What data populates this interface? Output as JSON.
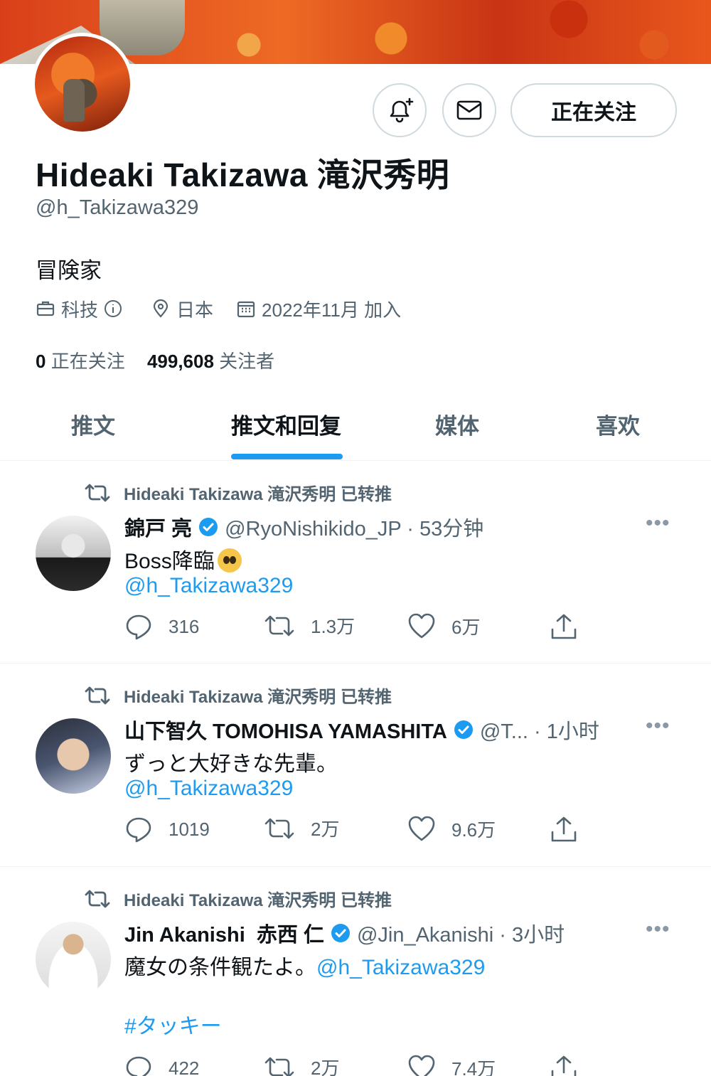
{
  "profile": {
    "display_name": "Hideaki Takizawa 滝沢秀明",
    "handle": "@h_Takizawa329",
    "bio": "冒険家",
    "category": "科技",
    "location": "日本",
    "joined": "2022年11月 加入",
    "following_count": "0",
    "following_label": "正在关注",
    "followers_count": "499,608",
    "followers_label": "关注者",
    "follow_button_label": "正在关注"
  },
  "tabs": [
    {
      "label": "推文",
      "active": false
    },
    {
      "label": "推文和回复",
      "active": true
    },
    {
      "label": "媒体",
      "active": false
    },
    {
      "label": "喜欢",
      "active": false
    }
  ],
  "retweet_label": "Hideaki Takizawa 滝沢秀明 已转推",
  "tweets": [
    {
      "display_name": "錦戸 亮",
      "handle_time": "@RyoNishikido_JP · 53分钟",
      "text": "Boss降臨",
      "mention": "@h_Takizawa329",
      "replies": "316",
      "retweets": "1.3万",
      "likes": "6万"
    },
    {
      "display_name": "山下智久 TOMOHISA YAMASHITA",
      "handle_time": "@T... · 1小时",
      "text": "ずっと大好きな先輩。",
      "mention": "@h_Takizawa329",
      "replies": "1019",
      "retweets": "2万",
      "likes": "9.6万"
    },
    {
      "display_name": "Jin Akanishi  赤西 仁",
      "handle_time": "@Jin_Akanishi · 3小时",
      "text": "魔女の条件観たよ。",
      "mention": "@h_Takizawa329",
      "hashtag": "#タッキー",
      "replies": "422",
      "retweets": "2万",
      "likes": "7.4万"
    }
  ],
  "more_glyph": "•••",
  "colors": {
    "accent": "#1d9bf0",
    "text_primary": "#0f1419",
    "text_secondary": "#536471",
    "border": "#cfd9de"
  },
  "icons": [
    "bell-plus-icon",
    "mail-icon",
    "briefcase-icon",
    "info-icon",
    "location-pin-icon",
    "calendar-icon",
    "retweet-icon",
    "verified-badge-icon",
    "reply-icon",
    "like-icon",
    "share-icon",
    "more-icon"
  ]
}
